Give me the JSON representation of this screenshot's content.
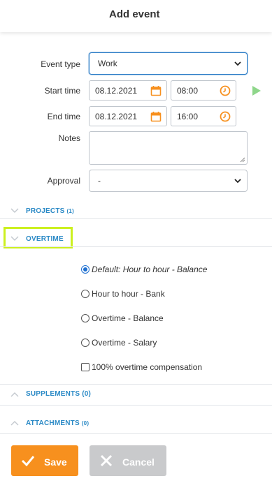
{
  "header": {
    "title": "Add event"
  },
  "form": {
    "event_type": {
      "label": "Event type",
      "value": "Work"
    },
    "start_time": {
      "label": "Start time",
      "date": "08.12.2021",
      "time": "08:00"
    },
    "end_time": {
      "label": "End time",
      "date": "08.12.2021",
      "time": "16:00"
    },
    "notes": {
      "label": "Notes",
      "value": ""
    },
    "approval": {
      "label": "Approval",
      "value": "-"
    }
  },
  "sections": {
    "projects": {
      "title": "PROJECTS",
      "count": "(1)"
    },
    "overtime": {
      "title": "OVERTIME"
    },
    "supplements": {
      "title": "SUPPLEMENTS (0)"
    },
    "attachments": {
      "title": "ATTACHMENTS",
      "count": "(0)"
    }
  },
  "overtime_options": [
    {
      "label": "Default: Hour to hour - Balance",
      "selected": true
    },
    {
      "label": "Hour to hour - Bank",
      "selected": false
    },
    {
      "label": "Overtime - Balance",
      "selected": false
    },
    {
      "label": "Overtime - Salary",
      "selected": false
    }
  ],
  "compensation_checkbox": {
    "label": "100% overtime compensation",
    "checked": false
  },
  "buttons": {
    "save": "Save",
    "cancel": "Cancel"
  },
  "colors": {
    "accent_blue": "#2b8ac6",
    "save_orange": "#f7901e",
    "cancel_gray": "#c9cacc",
    "highlight": "#ccf01f",
    "icon_orange": "#f7901e",
    "play_green": "#8ed68a"
  },
  "icons": [
    "chevron-down-icon",
    "calendar-icon",
    "clock-icon",
    "play-icon",
    "chevron-up-icon",
    "check-icon",
    "close-icon"
  ]
}
